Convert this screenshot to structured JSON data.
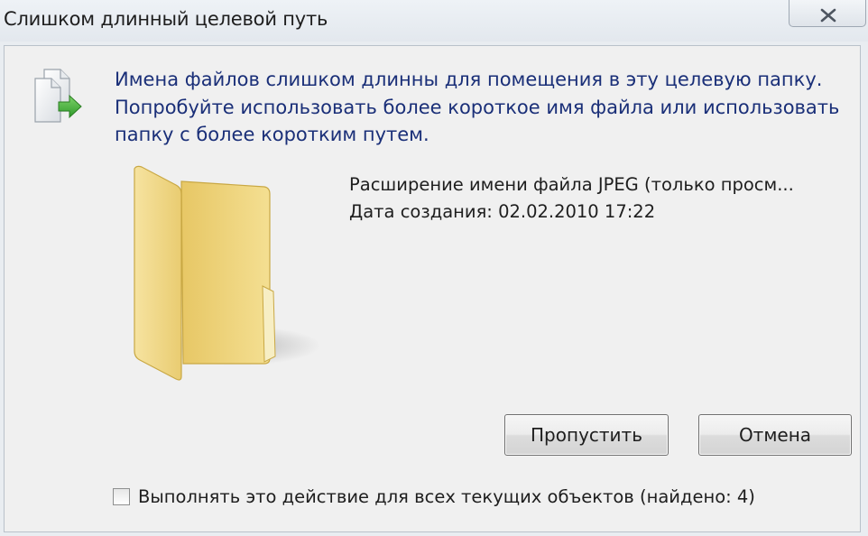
{
  "window": {
    "title": "Слишком длинный целевой путь",
    "close_icon": "close-icon"
  },
  "message": {
    "lines": [
      "Имена файлов слишком длинны для помещения в эту целевую папку.",
      "Попробуйте использовать более короткое имя файла или использовать",
      "папку с более коротким путем."
    ],
    "icon": "file-move-icon"
  },
  "item": {
    "icon": "folder-icon",
    "type_line": "Расширение имени файла JPEG (только просм...",
    "date_line": "Дата создания: 02.02.2010 17:22"
  },
  "buttons": {
    "skip_label": "Пропустить",
    "cancel_label": "Отмена"
  },
  "apply_all": {
    "label": "Выполнять это действие для всех текущих объектов (найдено: 4)",
    "checked": false
  },
  "colors": {
    "message_text": "#1a2f78",
    "folder_yellow": "#f2d67c"
  }
}
